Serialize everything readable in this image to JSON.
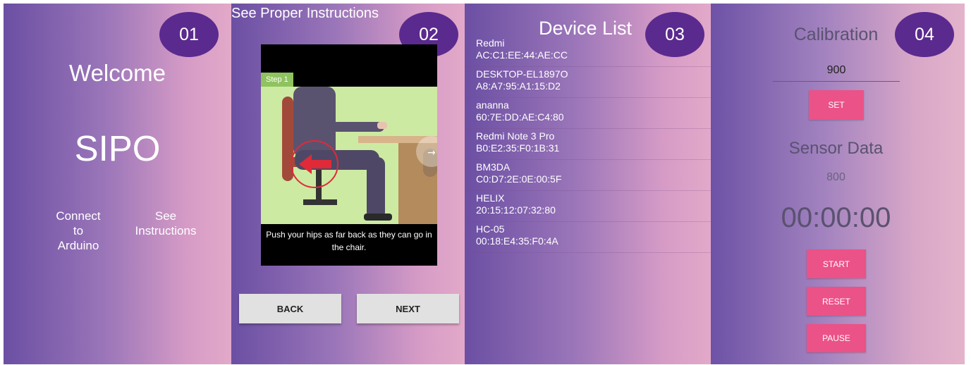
{
  "panel1": {
    "badge": "01",
    "welcome": "Welcome",
    "app_name": "SIPO",
    "connect_label": "Connect\nto\nArduino",
    "instructions_label": "See\nInstructions"
  },
  "panel2": {
    "badge": "02",
    "title": "See Proper Instructions",
    "step_label": "Step 1",
    "caption": "Push your hips as far back as they can go in the chair.",
    "back_label": "BACK",
    "next_label": "NEXT"
  },
  "panel3": {
    "badge": "03",
    "title": "Device List",
    "devices": [
      {
        "name": "Redmi",
        "mac": "AC:C1:EE:44:AE:CC"
      },
      {
        "name": "DESKTOP-EL1897O",
        "mac": "A8:A7:95:A1:15:D2"
      },
      {
        "name": "ananna",
        "mac": "60:7E:DD:AE:C4:80"
      },
      {
        "name": "Redmi Note 3 Pro",
        "mac": "B0:E2:35:F0:1B:31"
      },
      {
        "name": "BM3DA",
        "mac": "C0:D7:2E:0E:00:5F"
      },
      {
        "name": "HELIX",
        "mac": "20:15:12:07:32:80"
      },
      {
        "name": "HC-05",
        "mac": "00:18:E4:35:F0:4A"
      }
    ]
  },
  "panel4": {
    "badge": "04",
    "title": "Calibration",
    "calibration_value": "900",
    "set_label": "SET",
    "sensor_title": "Sensor Data",
    "sensor_value": "800",
    "timer": "00:00:00",
    "start_label": "START",
    "reset_label": "RESET",
    "pause_label": "PAUSE"
  },
  "colors": {
    "badge": "#5b2a8e",
    "accent_button": "#eb5287",
    "arrow": "#e02a38"
  }
}
